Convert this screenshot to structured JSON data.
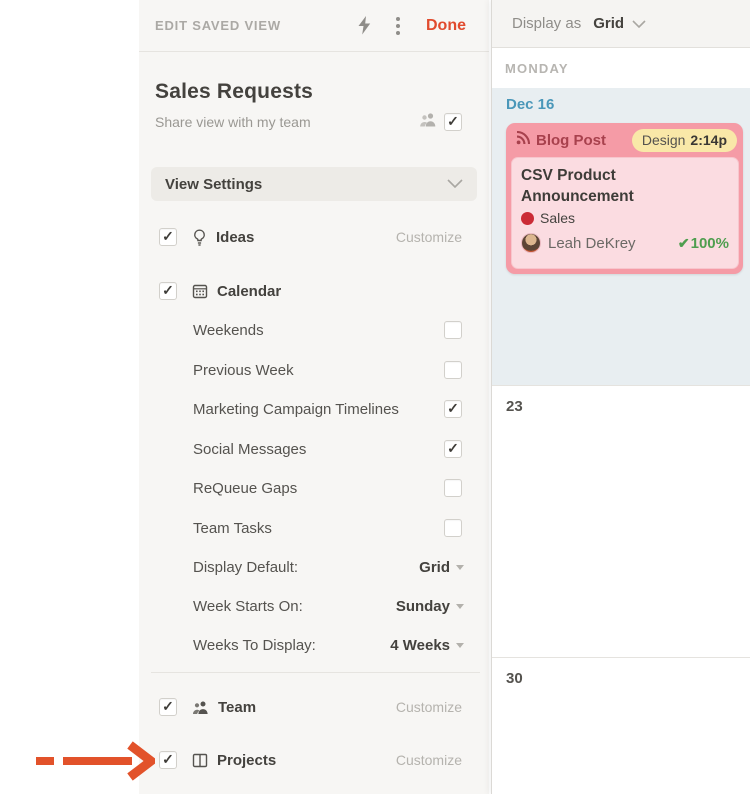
{
  "sidebar": {
    "title": "EDIT SAVED VIEW",
    "done": "Done",
    "view_name": "Sales Requests",
    "share": {
      "label": "Share view with my team",
      "checked": true
    },
    "view_settings_label": "View Settings",
    "ideas": {
      "label": "Ideas",
      "action": "Customize",
      "checked": true
    },
    "calendar_section": {
      "label": "Calendar",
      "checked": true
    },
    "options": [
      {
        "label": "Weekends",
        "checked": false
      },
      {
        "label": "Previous Week",
        "checked": false
      },
      {
        "label": "Marketing Campaign Timelines",
        "checked": true
      },
      {
        "label": "Social Messages",
        "checked": true
      },
      {
        "label": "ReQueue Gaps",
        "checked": false
      },
      {
        "label": "Team Tasks",
        "checked": false
      }
    ],
    "selects": [
      {
        "label": "Display Default:",
        "value": "Grid"
      },
      {
        "label": "Week Starts On:",
        "value": "Sunday"
      },
      {
        "label": "Weeks To Display:",
        "value": "4 Weeks"
      }
    ],
    "team": {
      "label": "Team",
      "action": "Customize",
      "checked": true
    },
    "projects": {
      "label": "Projects",
      "action": "Customize",
      "checked": true
    }
  },
  "calendar": {
    "display_as_label": "Display as",
    "display_as_value": "Grid",
    "day_header": "MONDAY",
    "week1_date": "Dec 16",
    "week2_date": "23",
    "week3_date": "30"
  },
  "card": {
    "type": "Blog Post",
    "badge_stage": "Design",
    "badge_time": "2:14p",
    "title": "CSV Product Announcement",
    "tag": "Sales",
    "owner": "Leah DeKrey",
    "progress": "100%"
  },
  "colors": {
    "done_red": "#e14b2e",
    "arrow_orange": "#e2522a",
    "card_header_pink": "#f59ba6",
    "card_body_pink": "#fbdce1",
    "badge_yellow": "#f9e8a8",
    "tag_red": "#cb2b36",
    "progress_green": "#4f9e4f",
    "date_blue": "#4a97b9",
    "week_highlight_blue": "#e8eef1"
  }
}
